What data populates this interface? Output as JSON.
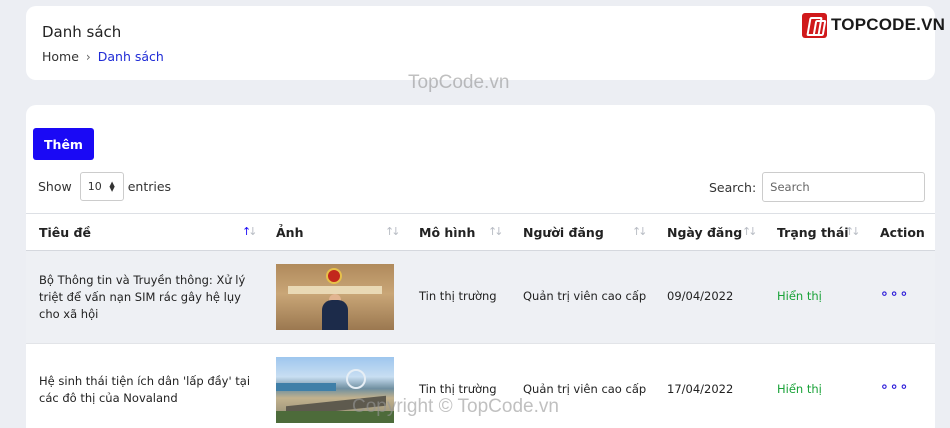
{
  "header": {
    "title": "Danh sách",
    "breadcrumb": {
      "home": "Home",
      "separator": "›",
      "current": "Danh sách"
    }
  },
  "logo": {
    "text": "TOPCODE.VN",
    "brand_color": "#d0191b"
  },
  "watermarks": {
    "top": "TopCode.vn",
    "bottom": "Copyright © TopCode.vn"
  },
  "toolbar": {
    "add_label": "Thêm",
    "accent": "#1a09f5"
  },
  "length": {
    "show_label": "Show",
    "value": "10",
    "entries_label": "entries"
  },
  "search": {
    "label": "Search:",
    "placeholder": "Search"
  },
  "table": {
    "columns": [
      {
        "label": "Tiêu đề",
        "sort_icon": "sort-asc-active-icon"
      },
      {
        "label": "Ảnh",
        "sort_icon": "sort-icon"
      },
      {
        "label": "Mô hình",
        "sort_icon": "sort-icon"
      },
      {
        "label": "Người đăng",
        "sort_icon": "sort-icon"
      },
      {
        "label": "Ngày đăng",
        "sort_icon": "sort-icon"
      },
      {
        "label": "Trạng thái",
        "sort_icon": "sort-icon"
      },
      {
        "label": "Action"
      }
    ],
    "rows": [
      {
        "title": "Bộ Thông tin và Truyền thông: Xử lý triệt để vấn nạn SIM rác gây hệ lụy cho xã hội",
        "image": "news-thumbnail-ministry-press",
        "model": "Tin thị trường",
        "author": "Quản trị viên cao cấp",
        "date": "09/04/2022",
        "status": "Hiển thị",
        "action": "∘∘∘"
      },
      {
        "title": "Hệ sinh thái tiện ích dân 'lấp đầy' tại các đô thị của Novaland",
        "image": "news-thumbnail-coastal-city",
        "model": "Tin thị trường",
        "author": "Quản trị viên cao cấp",
        "date": "17/04/2022",
        "status": "Hiển thị",
        "action": "∘∘∘"
      }
    ],
    "status_color": "#19a238"
  }
}
